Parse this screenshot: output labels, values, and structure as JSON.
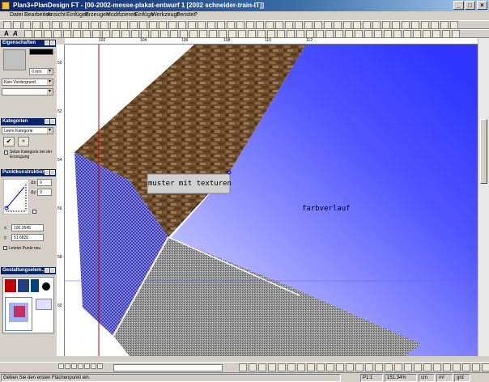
{
  "window": {
    "title": "Plan3+PlanDesign FT - [00-2002-messe-plakat-entwurf 1 [2002 schneider-train-IT]]"
  },
  "menu": [
    "Datei",
    "Bearbeiten",
    "Ansicht",
    "Einfügen",
    "Erzeugen",
    "Modifizieren",
    "Einfüge",
    "Werkzeuge",
    "Fenster",
    "?"
  ],
  "toolbar": {
    "bold": "A",
    "italic": "A"
  },
  "properties": {
    "title": "Eigenschaften",
    "line_width": "0 mm",
    "foreground": "Kein Vordergrund"
  },
  "categories": {
    "title": "Kategorien",
    "selected": "Leere Kategorie",
    "set_on_create": "Setze Kategorie bei der Erzeugung"
  },
  "point_construction": {
    "title": "Punktkonstruktion",
    "dx_label": "Δx:",
    "dy_label": "Δy:",
    "dx": "0",
    "dy": "0",
    "x_label": "x:",
    "y_label": "y:",
    "x": "100.2645",
    "y": "51.6826",
    "last_point": "Letzter Punkt neu"
  },
  "design": {
    "title": "Gestaltungselem..."
  },
  "ruler": {
    "h_ticks": [
      "102",
      "104",
      "106",
      "108",
      "110",
      "112"
    ],
    "v_ticks": [
      "50",
      "52",
      "54",
      "56",
      "58",
      "60"
    ]
  },
  "canvas": {
    "label_texture": "muster mit texturen",
    "label_gradient": "farbverlauf",
    "colors": {
      "blue": "#3f45ff",
      "blue_light": "#c8c8ff",
      "brown": "#6b4a2a",
      "granite": "#8c8c8c",
      "checker": "#6060d0"
    }
  },
  "status": {
    "message": "Geben Sie den ersten Flächenpunkt ein.",
    "page": "P1:1",
    "zoom": "151.34%",
    "unit1": "cm",
    "unit2": "m²",
    "unit3": "grd"
  }
}
